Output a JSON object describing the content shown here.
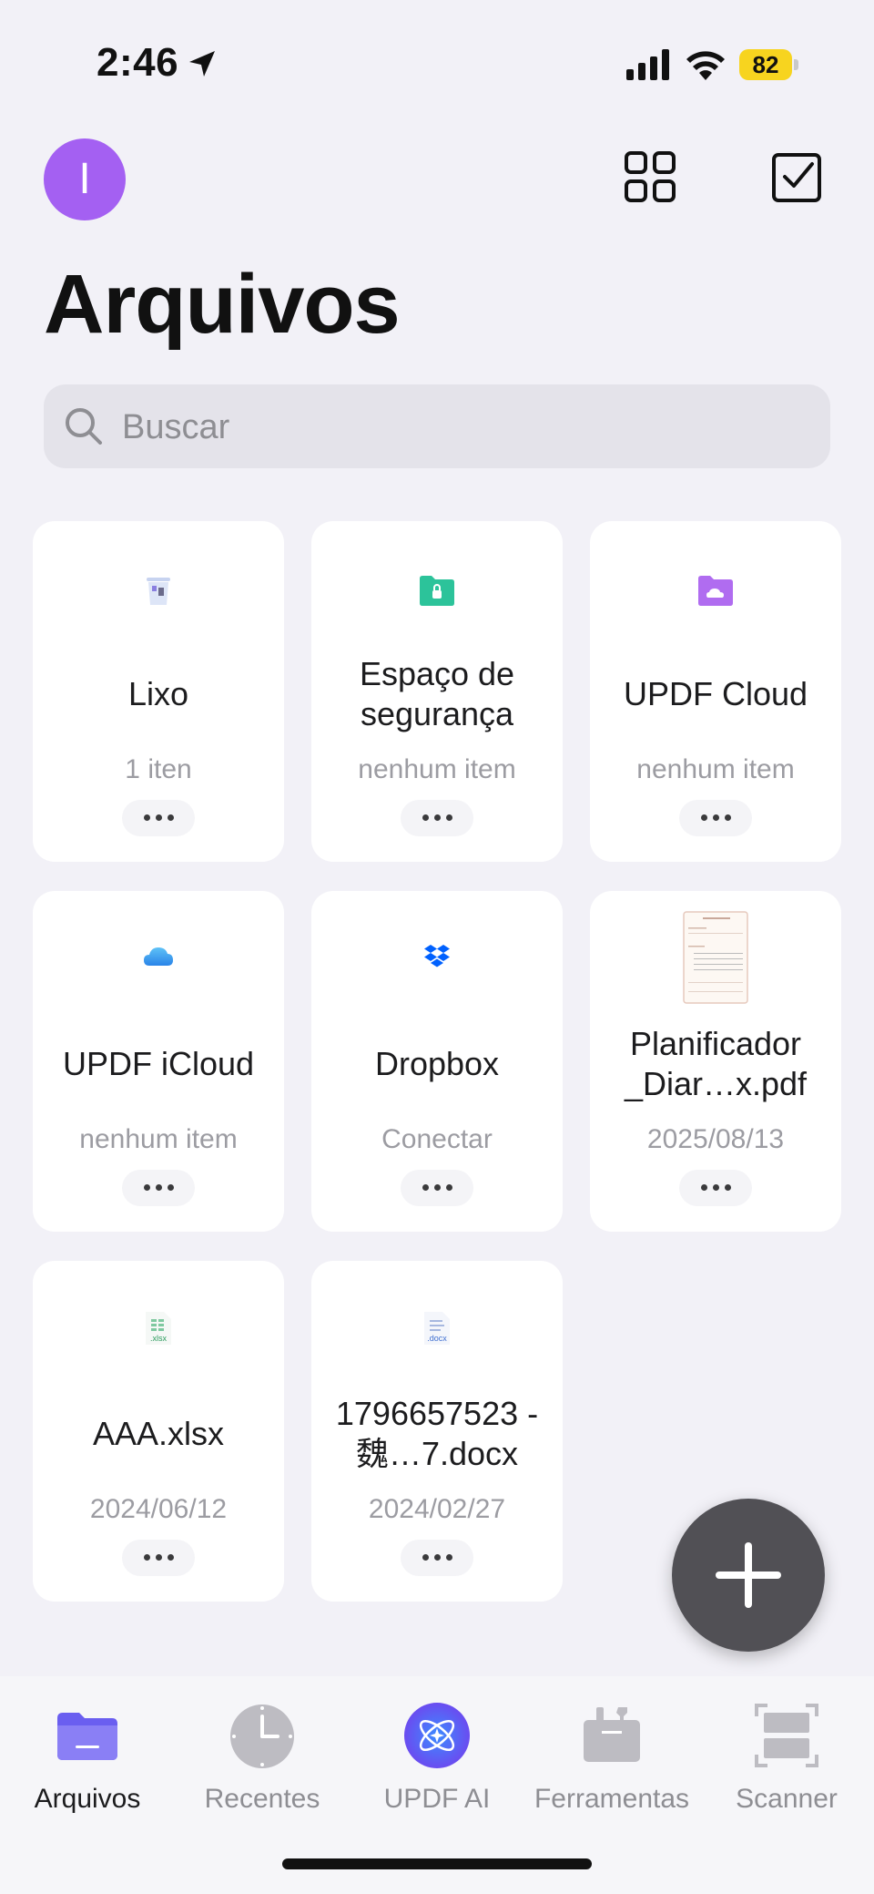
{
  "status_bar": {
    "time": "2:46",
    "battery": "82"
  },
  "header": {
    "avatar_letter": "I",
    "title": "Arquivos"
  },
  "search": {
    "placeholder": "Buscar"
  },
  "cards": [
    {
      "name": "Lixo",
      "sub": "1 iten",
      "icon": "trash-icon"
    },
    {
      "name": "Espaço de segurança",
      "sub": "nenhum item",
      "icon": "secure-folder-icon"
    },
    {
      "name": "UPDF Cloud",
      "sub": "nenhum item",
      "icon": "cloud-folder-icon"
    },
    {
      "name": "UPDF iCloud",
      "sub": "nenhum item",
      "icon": "icloud-icon"
    },
    {
      "name": "Dropbox",
      "sub": "Conectar",
      "icon": "dropbox-icon"
    },
    {
      "name": "Planificador _Diar…x.pdf",
      "sub": "2025/08/13",
      "icon": "pdf-thumbnail"
    },
    {
      "name": "AAA.xlsx",
      "sub": "2024/06/12",
      "icon": "xlsx-file-icon",
      "file_badge": ".xlsx"
    },
    {
      "name": "1796657523 - 魏…7.docx",
      "sub": "2024/02/27",
      "icon": "docx-file-icon",
      "file_badge": ".docx"
    }
  ],
  "tabs": [
    {
      "label": "Arquivos",
      "icon": "folder-icon",
      "active": true
    },
    {
      "label": "Recentes",
      "icon": "clock-icon",
      "active": false
    },
    {
      "label": "UPDF AI",
      "icon": "ai-icon",
      "active": false
    },
    {
      "label": "Ferramentas",
      "icon": "toolbox-icon",
      "active": false
    },
    {
      "label": "Scanner",
      "icon": "scanner-icon",
      "active": false
    }
  ],
  "colors": {
    "accent": "#a460f2",
    "battery": "#f7d41f",
    "fab": "#515055"
  }
}
